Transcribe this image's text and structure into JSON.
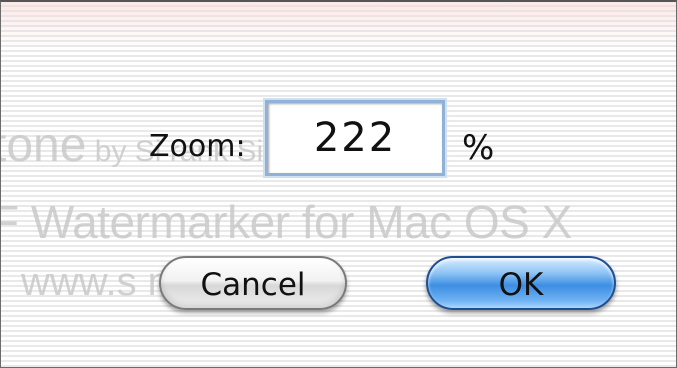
{
  "dialog": {
    "zoom_label": "Zoom:",
    "zoom_value": "222",
    "unit": "%",
    "cancel_label": "Cancel",
    "ok_label": "OK"
  },
  "watermark": {
    "line1_big": "tone",
    "line1_small": " by Si                           rank Siegar",
    "line2": "F Watermarker for Mac OS X",
    "line3": "www.s                    m"
  },
  "colors": {
    "default_button": "#3d8ee3",
    "focus_ring": "#8fb2d6",
    "watermark_text": "#c9c9c9"
  }
}
